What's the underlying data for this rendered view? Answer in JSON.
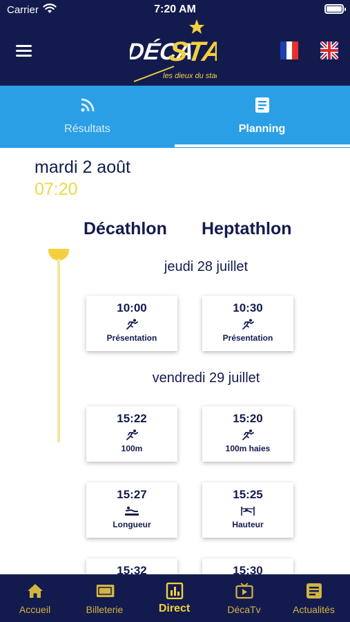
{
  "status_bar": {
    "carrier": "Carrier",
    "time": "7:20 AM"
  },
  "header": {
    "logo_text": "DÉCASTAR",
    "logo_tagline": "les dieux du stade",
    "flags": [
      "fr-flag",
      "uk-flag"
    ]
  },
  "tabs": [
    {
      "label": "Résultats",
      "icon": "rss-icon",
      "active": false
    },
    {
      "label": "Planning",
      "icon": "document-icon",
      "active": true
    }
  ],
  "current": {
    "date": "mardi 2 août",
    "time": "07:20"
  },
  "columns": [
    "Décathlon",
    "Heptathlon"
  ],
  "schedule": [
    {
      "day": "jeudi 28 juillet",
      "rows": [
        [
          {
            "time": "10:00",
            "event": "Présentation",
            "icon": "runner-icon"
          },
          {
            "time": "10:30",
            "event": "Présentation",
            "icon": "runner-icon"
          }
        ]
      ]
    },
    {
      "day": "vendredi 29 juillet",
      "rows": [
        [
          {
            "time": "15:22",
            "event": "100m",
            "icon": "runner-icon"
          },
          {
            "time": "15:20",
            "event": "100m haies",
            "icon": "runner-icon"
          }
        ],
        [
          {
            "time": "15:27",
            "event": "Longueur",
            "icon": "long-jump-icon"
          },
          {
            "time": "15:25",
            "event": "Hauteur",
            "icon": "high-jump-icon"
          }
        ],
        [
          {
            "time": "15:32",
            "event": "",
            "icon": ""
          },
          {
            "time": "15:30",
            "event": "",
            "icon": ""
          }
        ]
      ]
    }
  ],
  "bottom_nav": [
    {
      "label": "Accueil",
      "icon": "home-icon",
      "active": false
    },
    {
      "label": "Billeterie",
      "icon": "ticket-icon",
      "active": false
    },
    {
      "label": "Direct",
      "icon": "live-chart-icon",
      "active": true
    },
    {
      "label": "DécaTv",
      "icon": "tv-icon",
      "active": false
    },
    {
      "label": "Actualités",
      "icon": "news-icon",
      "active": false
    }
  ],
  "colors": {
    "navy": "#131b4e",
    "tab_blue": "#2b9fe6",
    "gold": "#f4d03f",
    "nav_gold": "#d4b441"
  }
}
